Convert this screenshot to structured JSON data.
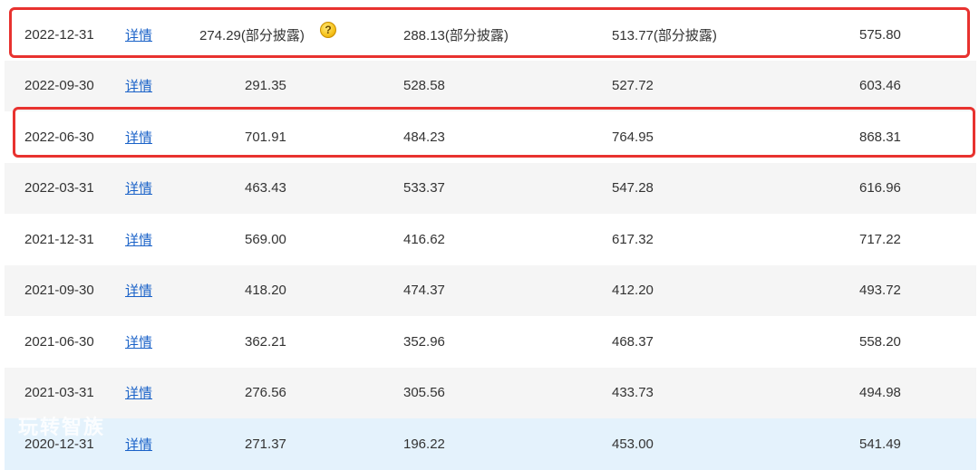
{
  "rows": [
    {
      "date": "2022-12-31",
      "link": "详情",
      "v1": "274.29(部分披露)",
      "v2": "288.13(部分披露)",
      "v3": "513.77(部分披露)",
      "v4": "575.80"
    },
    {
      "date": "2022-09-30",
      "link": "详情",
      "v1": "291.35",
      "v2": "528.58",
      "v3": "527.72",
      "v4": "603.46"
    },
    {
      "date": "2022-06-30",
      "link": "详情",
      "v1": "701.91",
      "v2": "484.23",
      "v3": "764.95",
      "v4": "868.31"
    },
    {
      "date": "2022-03-31",
      "link": "详情",
      "v1": "463.43",
      "v2": "533.37",
      "v3": "547.28",
      "v4": "616.96"
    },
    {
      "date": "2021-12-31",
      "link": "详情",
      "v1": "569.00",
      "v2": "416.62",
      "v3": "617.32",
      "v4": "717.22"
    },
    {
      "date": "2021-09-30",
      "link": "详情",
      "v1": "418.20",
      "v2": "474.37",
      "v3": "412.20",
      "v4": "493.72"
    },
    {
      "date": "2021-06-30",
      "link": "详情",
      "v1": "362.21",
      "v2": "352.96",
      "v3": "468.37",
      "v4": "558.20"
    },
    {
      "date": "2021-03-31",
      "link": "详情",
      "v1": "276.56",
      "v2": "305.56",
      "v3": "433.73",
      "v4": "494.98"
    },
    {
      "date": "2020-12-31",
      "link": "详情",
      "v1": "271.37",
      "v2": "196.22",
      "v3": "453.00",
      "v4": "541.49"
    }
  ],
  "help_icon": {
    "glyph": "?",
    "icon": "question-help-icon"
  },
  "watermark": "玩转智族",
  "colors": {
    "highlight": "#e8322f",
    "link": "#1a62c8",
    "selected_row": "#e4f2fc",
    "alt_row": "#f5f5f5"
  }
}
